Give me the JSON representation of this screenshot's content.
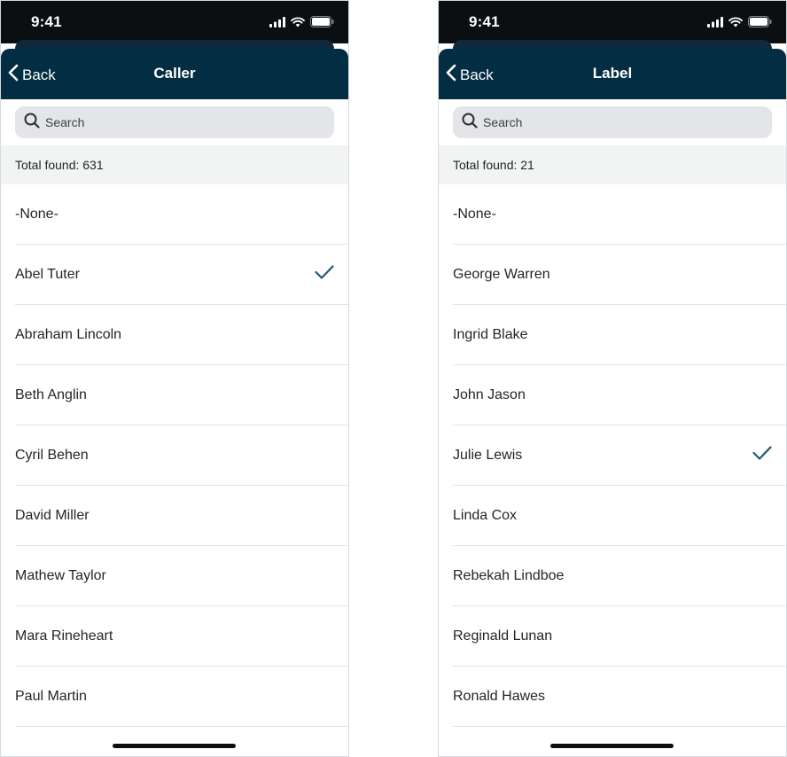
{
  "colors": {
    "status_bar": "#0b0f12",
    "nav_bar": "#032d42",
    "check": "#1c5a75",
    "search_bg": "#e3e5e8",
    "total_bg": "#f2f3f3"
  },
  "screens": [
    {
      "status": {
        "time": "9:41",
        "icons": [
          "signal-icon",
          "wifi-icon",
          "battery-icon"
        ]
      },
      "nav": {
        "back_label": "Back",
        "title": "Caller"
      },
      "search": {
        "placeholder": "Search",
        "value": ""
      },
      "total": "Total found: 631",
      "items": [
        {
          "label": "-None-",
          "selected": false
        },
        {
          "label": "Abel Tuter",
          "selected": true
        },
        {
          "label": "Abraham Lincoln",
          "selected": false
        },
        {
          "label": "Beth Anglin",
          "selected": false
        },
        {
          "label": "Cyril Behen",
          "selected": false
        },
        {
          "label": "David Miller",
          "selected": false
        },
        {
          "label": "Mathew Taylor",
          "selected": false
        },
        {
          "label": "Mara Rineheart",
          "selected": false
        },
        {
          "label": "Paul Martin",
          "selected": false
        }
      ]
    },
    {
      "status": {
        "time": "9:41",
        "icons": [
          "signal-icon",
          "wifi-icon",
          "battery-icon"
        ]
      },
      "nav": {
        "back_label": "Back",
        "title": "Label"
      },
      "search": {
        "placeholder": "Search",
        "value": ""
      },
      "total": "Total found: 21",
      "items": [
        {
          "label": "-None-",
          "selected": false
        },
        {
          "label": "George Warren",
          "selected": false
        },
        {
          "label": "Ingrid Blake",
          "selected": false
        },
        {
          "label": "John Jason",
          "selected": false
        },
        {
          "label": "Julie Lewis",
          "selected": true
        },
        {
          "label": "Linda Cox",
          "selected": false
        },
        {
          "label": "Rebekah Lindboe",
          "selected": false
        },
        {
          "label": "Reginald Lunan",
          "selected": false
        },
        {
          "label": "Ronald Hawes",
          "selected": false
        }
      ]
    }
  ]
}
